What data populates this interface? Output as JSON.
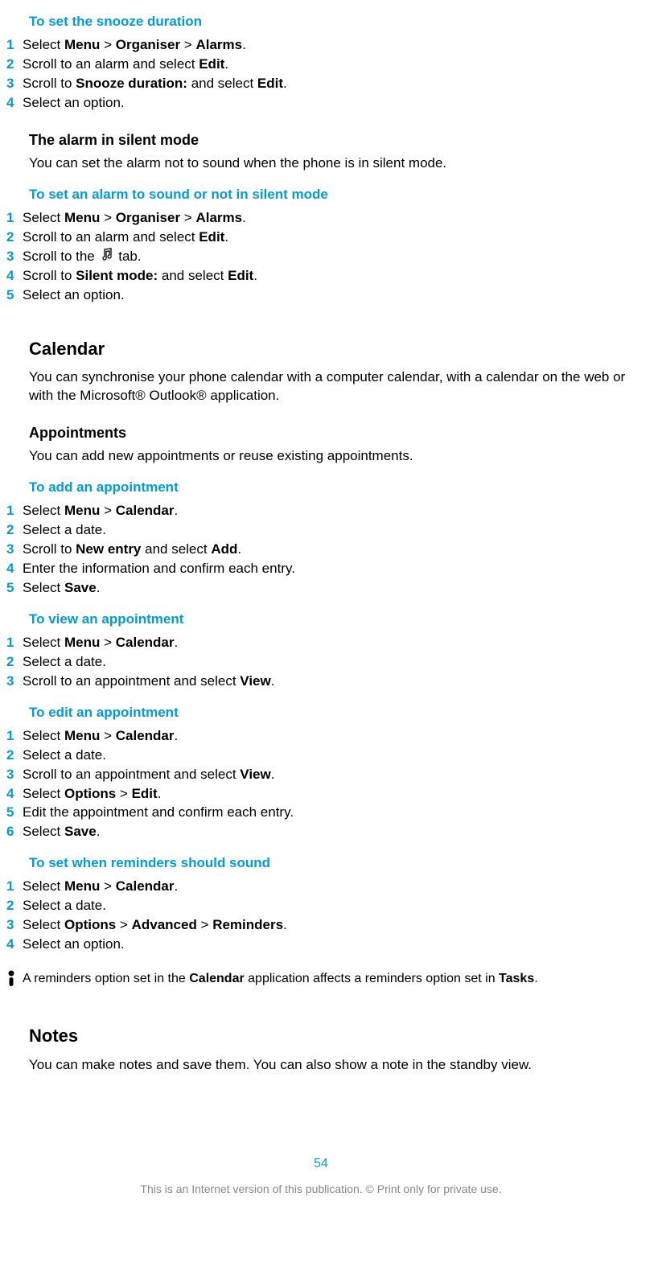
{
  "sec1": {
    "title": "To set the snooze duration",
    "steps": [
      {
        "n": "1",
        "parts": [
          "Select ",
          [
            "b",
            "Menu"
          ],
          " > ",
          [
            "b",
            "Organiser"
          ],
          " > ",
          [
            "b",
            "Alarms"
          ],
          "."
        ]
      },
      {
        "n": "2",
        "parts": [
          "Scroll to an alarm and select ",
          [
            "b",
            "Edit"
          ],
          "."
        ]
      },
      {
        "n": "3",
        "parts": [
          "Scroll to ",
          [
            "b",
            "Snooze duration:"
          ],
          " and select ",
          [
            "b",
            "Edit"
          ],
          "."
        ]
      },
      {
        "n": "4",
        "parts": [
          "Select an option."
        ]
      }
    ]
  },
  "silent": {
    "heading": "The alarm in silent mode",
    "body": "You can set the alarm not to sound when the phone is in silent mode."
  },
  "sec2": {
    "title": "To set an alarm to sound or not in silent mode",
    "steps": [
      {
        "n": "1",
        "parts": [
          "Select ",
          [
            "b",
            "Menu"
          ],
          " > ",
          [
            "b",
            "Organiser"
          ],
          " > ",
          [
            "b",
            "Alarms"
          ],
          "."
        ]
      },
      {
        "n": "2",
        "parts": [
          "Scroll to an alarm and select ",
          [
            "b",
            "Edit"
          ],
          "."
        ]
      },
      {
        "n": "3",
        "parts": [
          "Scroll to the ",
          [
            "icon",
            "music"
          ],
          " tab."
        ]
      },
      {
        "n": "4",
        "parts": [
          "Scroll to ",
          [
            "b",
            "Silent mode:"
          ],
          " and select ",
          [
            "b",
            "Edit"
          ],
          "."
        ]
      },
      {
        "n": "5",
        "parts": [
          "Select an option."
        ]
      }
    ]
  },
  "calendar": {
    "heading": "Calendar",
    "body": "You can synchronise your phone calendar with a computer calendar, with a calendar on the web or with the Microsoft® Outlook® application."
  },
  "appointments": {
    "heading": "Appointments",
    "body": "You can add new appointments or reuse existing appointments."
  },
  "sec3": {
    "title": "To add an appointment",
    "steps": [
      {
        "n": "1",
        "parts": [
          "Select ",
          [
            "b",
            "Menu"
          ],
          " > ",
          [
            "b",
            "Calendar"
          ],
          "."
        ]
      },
      {
        "n": "2",
        "parts": [
          "Select a date."
        ]
      },
      {
        "n": "3",
        "parts": [
          "Scroll to ",
          [
            "b",
            "New entry"
          ],
          " and select ",
          [
            "b",
            "Add"
          ],
          "."
        ]
      },
      {
        "n": "4",
        "parts": [
          "Enter the information and confirm each entry."
        ]
      },
      {
        "n": "5",
        "parts": [
          "Select ",
          [
            "b",
            "Save"
          ],
          "."
        ]
      }
    ]
  },
  "sec4": {
    "title": "To view an appointment",
    "steps": [
      {
        "n": "1",
        "parts": [
          "Select ",
          [
            "b",
            "Menu"
          ],
          " > ",
          [
            "b",
            "Calendar"
          ],
          "."
        ]
      },
      {
        "n": "2",
        "parts": [
          "Select a date."
        ]
      },
      {
        "n": "3",
        "parts": [
          "Scroll to an appointment and select ",
          [
            "b",
            "View"
          ],
          "."
        ]
      }
    ]
  },
  "sec5": {
    "title": "To edit an appointment",
    "steps": [
      {
        "n": "1",
        "parts": [
          "Select ",
          [
            "b",
            "Menu"
          ],
          " > ",
          [
            "b",
            "Calendar"
          ],
          "."
        ]
      },
      {
        "n": "2",
        "parts": [
          "Select a date."
        ]
      },
      {
        "n": "3",
        "parts": [
          "Scroll to an appointment and select ",
          [
            "b",
            "View"
          ],
          "."
        ]
      },
      {
        "n": "4",
        "parts": [
          "Select ",
          [
            "b",
            "Options"
          ],
          " > ",
          [
            "b",
            "Edit"
          ],
          "."
        ]
      },
      {
        "n": "5",
        "parts": [
          "Edit the appointment and confirm each entry."
        ]
      },
      {
        "n": "6",
        "parts": [
          "Select ",
          [
            "b",
            "Save"
          ],
          "."
        ]
      }
    ]
  },
  "sec6": {
    "title": "To set when reminders should sound",
    "steps": [
      {
        "n": "1",
        "parts": [
          "Select ",
          [
            "b",
            "Menu"
          ],
          " > ",
          [
            "b",
            "Calendar"
          ],
          "."
        ]
      },
      {
        "n": "2",
        "parts": [
          "Select a date."
        ]
      },
      {
        "n": "3",
        "parts": [
          "Select ",
          [
            "b",
            "Options"
          ],
          " > ",
          [
            "b",
            "Advanced"
          ],
          " > ",
          [
            "b",
            "Reminders"
          ],
          "."
        ]
      },
      {
        "n": "4",
        "parts": [
          "Select an option."
        ]
      }
    ]
  },
  "note": {
    "parts": [
      "A reminders option set in the ",
      [
        "b",
        "Calendar"
      ],
      " application affects a reminders option set in ",
      [
        "b",
        "Tasks"
      ],
      "."
    ]
  },
  "notes": {
    "heading": "Notes",
    "body": "You can make notes and save them. You can also show a note in the standby view."
  },
  "pagenum": "54",
  "footer": "This is an Internet version of this publication. © Print only for private use."
}
